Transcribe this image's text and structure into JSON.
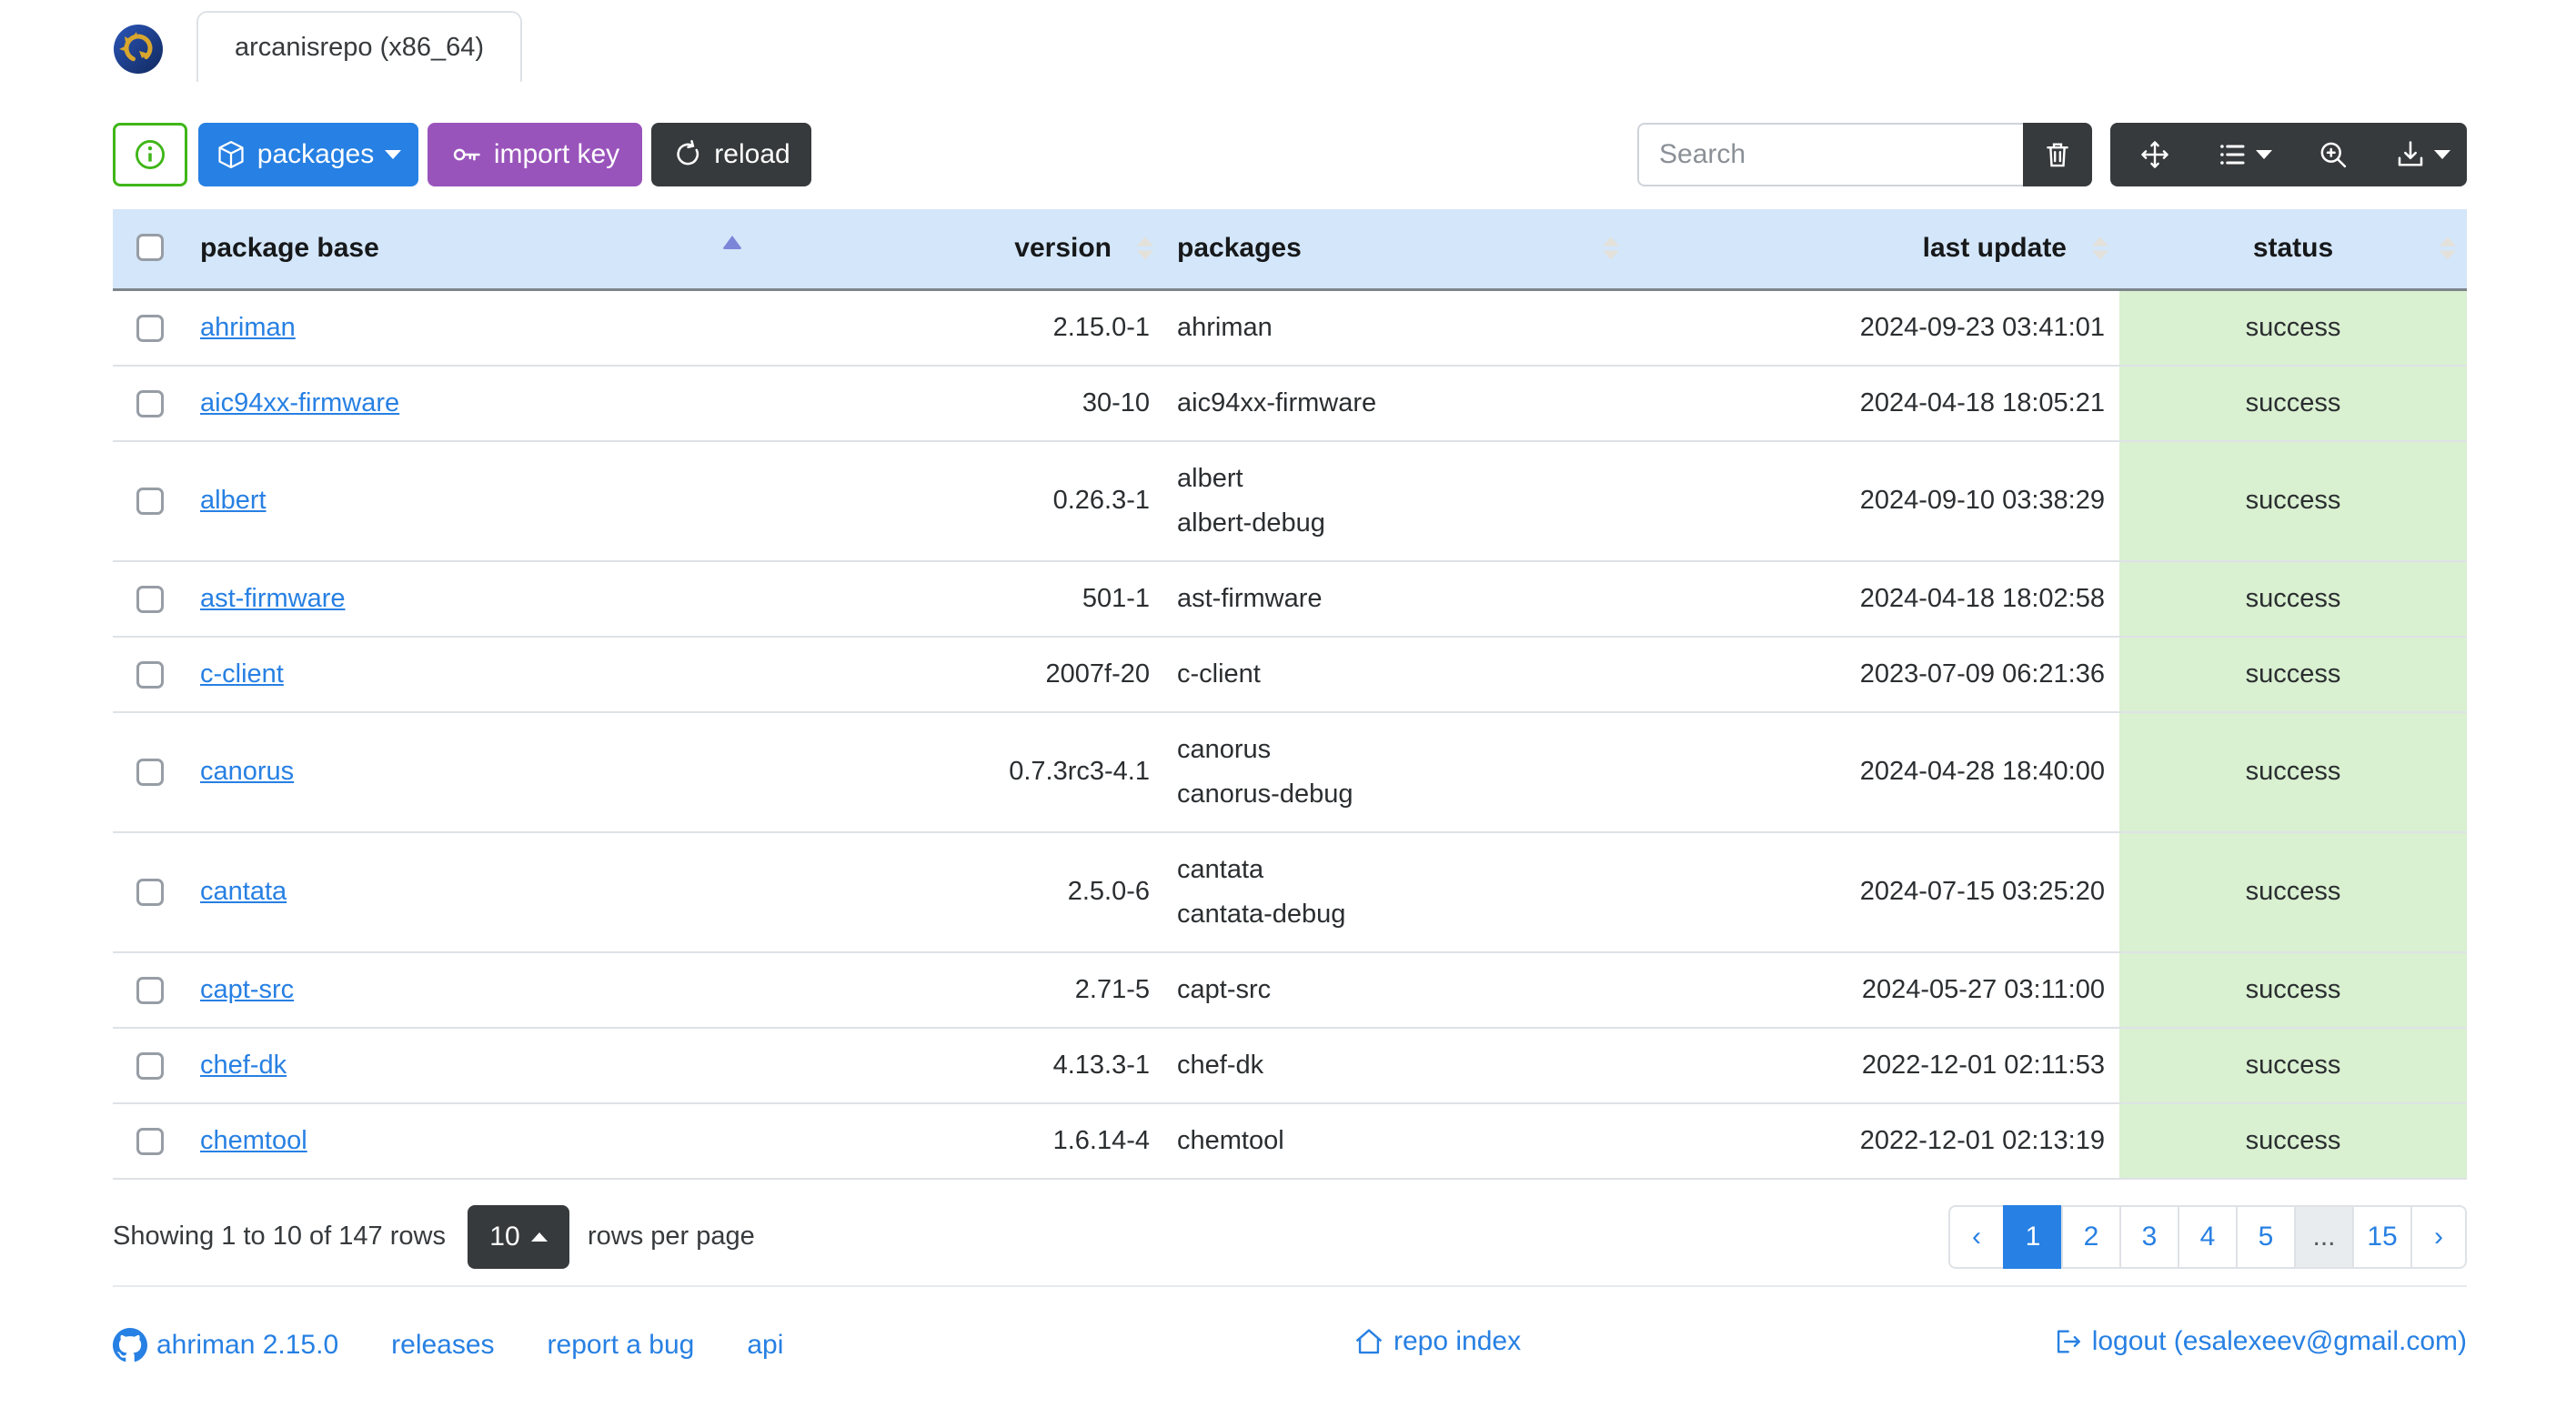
{
  "window": {
    "tab_label": "arcanisrepo (x86_64)"
  },
  "toolbar": {
    "packages_label": "packages",
    "import_key_label": "import key",
    "reload_label": "reload",
    "search_placeholder": "Search",
    "icons": [
      "info-icon",
      "box-icon",
      "caret-down-icon",
      "key-icon",
      "arrow-clockwise-icon",
      "trash-icon",
      "arrows-move-icon",
      "list-columns-icon",
      "zoom-in-icon",
      "download-icon"
    ]
  },
  "table": {
    "headers": {
      "base": "package base",
      "version": "version",
      "packages": "packages",
      "last_update": "last update",
      "status": "status"
    },
    "sort": {
      "column": "package base",
      "direction": "asc"
    },
    "rows": [
      {
        "base": "ahriman",
        "version": "2.15.0-1",
        "packages": "ahriman",
        "updated": "2024-09-23 03:41:01",
        "status": "success"
      },
      {
        "base": "aic94xx-firmware",
        "version": "30-10",
        "packages": "aic94xx-firmware",
        "updated": "2024-04-18 18:05:21",
        "status": "success"
      },
      {
        "base": "albert",
        "version": "0.26.3-1",
        "packages": "albert\nalbert-debug",
        "updated": "2024-09-10 03:38:29",
        "status": "success"
      },
      {
        "base": "ast-firmware",
        "version": "501-1",
        "packages": "ast-firmware",
        "updated": "2024-04-18 18:02:58",
        "status": "success"
      },
      {
        "base": "c-client",
        "version": "2007f-20",
        "packages": "c-client",
        "updated": "2023-07-09 06:21:36",
        "status": "success"
      },
      {
        "base": "canorus",
        "version": "0.7.3rc3-4.1",
        "packages": "canorus\ncanorus-debug",
        "updated": "2024-04-28 18:40:00",
        "status": "success"
      },
      {
        "base": "cantata",
        "version": "2.5.0-6",
        "packages": "cantata\ncantata-debug",
        "updated": "2024-07-15 03:25:20",
        "status": "success"
      },
      {
        "base": "capt-src",
        "version": "2.71-5",
        "packages": "capt-src",
        "updated": "2024-05-27 03:11:00",
        "status": "success"
      },
      {
        "base": "chef-dk",
        "version": "4.13.3-1",
        "packages": "chef-dk",
        "updated": "2022-12-01 02:11:53",
        "status": "success"
      },
      {
        "base": "chemtool",
        "version": "1.6.14-4",
        "packages": "chemtool",
        "updated": "2022-12-01 02:13:19",
        "status": "success"
      }
    ]
  },
  "pagination": {
    "summary": "Showing 1 to 10 of 147 rows",
    "page_size": "10",
    "page_size_suffix": "rows per page",
    "pages": [
      "‹",
      "1",
      "2",
      "3",
      "4",
      "5",
      "...",
      "15",
      "›"
    ],
    "active_page": "1"
  },
  "footer": {
    "version_label": "ahriman 2.15.0",
    "releases_label": "releases",
    "report_bug_label": "report a bug",
    "api_label": "api",
    "repo_index_label": "repo index",
    "logout_label": "logout (esalexeev@gmail.com)"
  },
  "colors": {
    "primary": "#2780e3",
    "success": "#3fb618",
    "info_purple": "#9954bb",
    "dark": "#373a3c",
    "table_header_bg": "#d4e6f9",
    "table_success_bg": "#d9f0d1",
    "sort_active_caret": "#7b86d9"
  }
}
